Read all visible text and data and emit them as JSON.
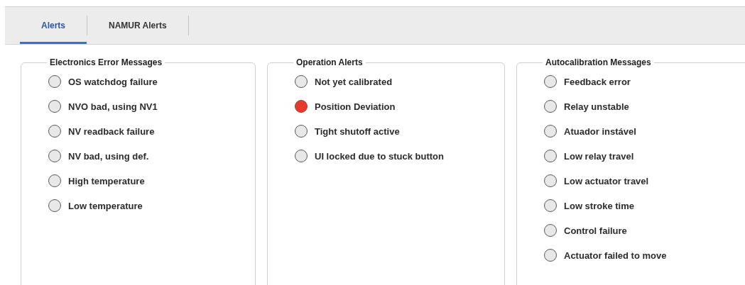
{
  "tabs": [
    {
      "label": "Alerts",
      "selected": true
    },
    {
      "label": "NAMUR Alerts",
      "selected": false
    }
  ],
  "groups": [
    {
      "title": "Electronics Error Messages",
      "items": [
        {
          "label": "OS watchdog failure",
          "on": false
        },
        {
          "label": "NVO bad, using NV1",
          "on": false
        },
        {
          "label": "NV readback failure",
          "on": false
        },
        {
          "label": "NV bad, using def.",
          "on": false
        },
        {
          "label": "High temperature",
          "on": false
        },
        {
          "label": "Low temperature",
          "on": false
        }
      ]
    },
    {
      "title": "Operation Alerts",
      "items": [
        {
          "label": "Not yet calibrated",
          "on": false
        },
        {
          "label": "Position Deviation",
          "on": true
        },
        {
          "label": "Tight shutoff active",
          "on": false
        },
        {
          "label": "UI locked due to stuck button",
          "on": false
        }
      ]
    },
    {
      "title": "Autocalibration Messages",
      "items": [
        {
          "label": "Feedback error",
          "on": false
        },
        {
          "label": "Relay unstable",
          "on": false
        },
        {
          "label": "Atuador instável",
          "on": false
        },
        {
          "label": "Low relay travel",
          "on": false
        },
        {
          "label": "Low actuator travel",
          "on": false
        },
        {
          "label": "Low stroke time",
          "on": false
        },
        {
          "label": "Control failure",
          "on": false
        },
        {
          "label": "Actuator failed to move",
          "on": false
        }
      ]
    }
  ]
}
